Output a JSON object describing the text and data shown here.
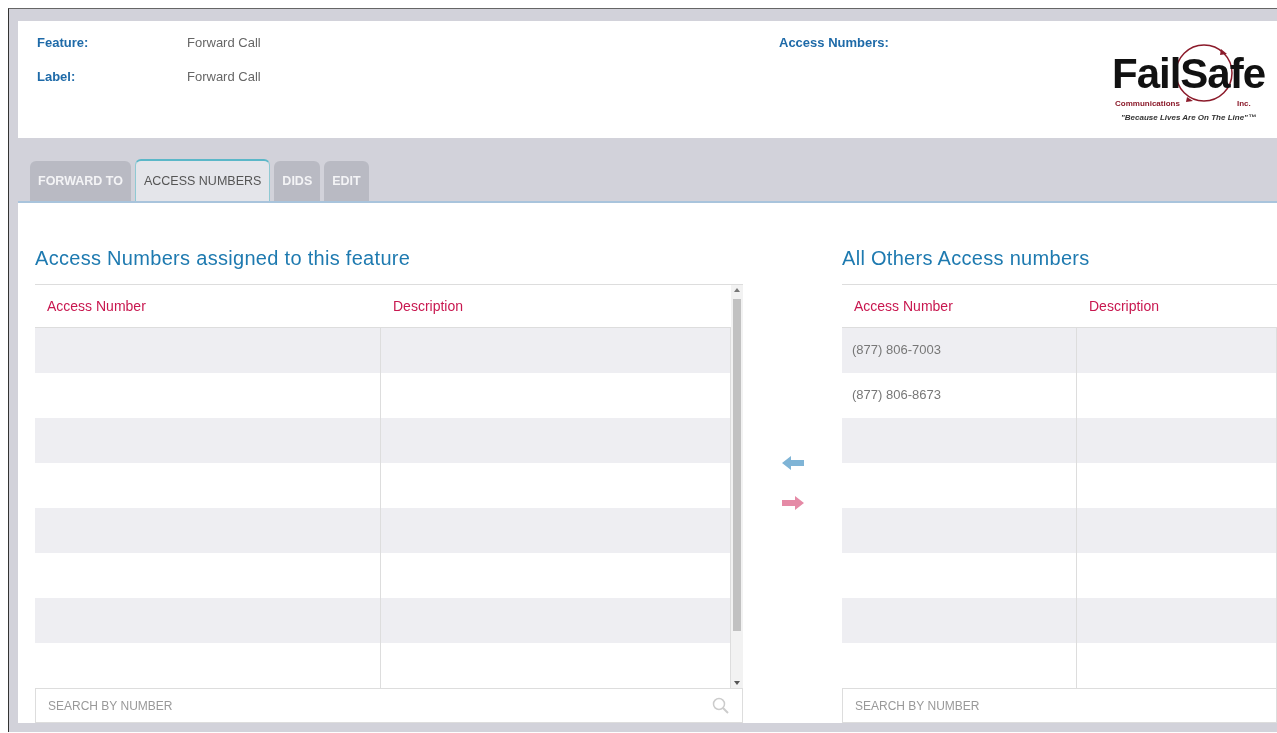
{
  "header": {
    "fields": [
      {
        "label": "Feature:",
        "value": "Forward Call"
      },
      {
        "label": "Label:",
        "value": "Forward Call"
      }
    ],
    "access_numbers_label": "Access Numbers:",
    "logo": {
      "name_start": "Fail",
      "name_end": "Safe",
      "sub_left": "Communications",
      "sub_right": "Inc.",
      "tagline": "\"Because Lives Are On The Line\"™"
    }
  },
  "tabs": [
    {
      "label": "FORWARD TO",
      "selected": false
    },
    {
      "label": "ACCESS NUMBERS",
      "selected": true
    },
    {
      "label": "DIDS",
      "selected": false
    },
    {
      "label": "EDIT",
      "selected": false
    }
  ],
  "assigned": {
    "title": "Access Numbers assigned to this feature",
    "columns": [
      "Access Number",
      "Description"
    ],
    "search_placeholder": "SEARCH BY NUMBER"
  },
  "others": {
    "title": "All Others Access numbers",
    "columns": [
      "Access Number",
      "Description"
    ],
    "rows": [
      {
        "access_number": "(877) 806-7003"
      },
      {
        "access_number": "(877) 806-8673"
      }
    ],
    "search_placeholder": "SEARCH BY NUMBER"
  }
}
